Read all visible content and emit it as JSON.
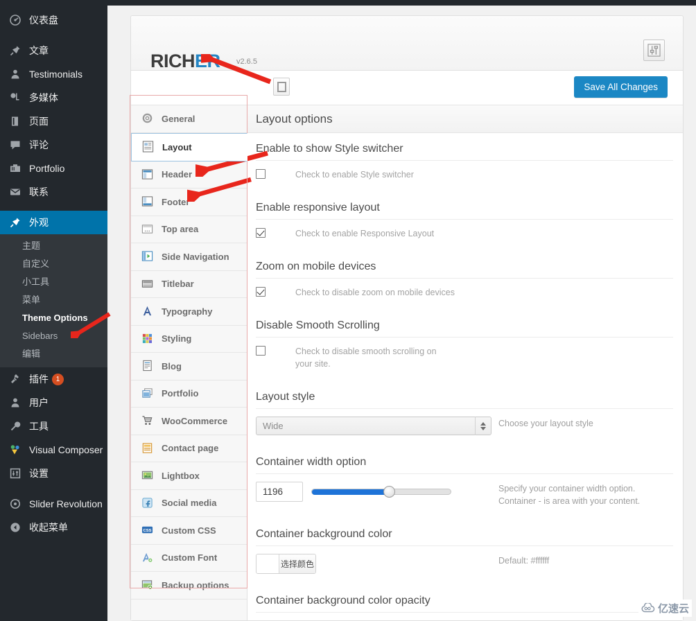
{
  "wp_sidebar": {
    "items": [
      {
        "label": "仪表盘",
        "icon": "dashboard-icon",
        "glyph": "◉"
      },
      {
        "label": "文章",
        "icon": "pin-icon",
        "glyph": "✒"
      },
      {
        "label": "Testimonials",
        "icon": "person-icon",
        "glyph": "👤"
      },
      {
        "label": "多媒体",
        "icon": "media-icon",
        "glyph": "♫"
      },
      {
        "label": "页面",
        "icon": "page-icon",
        "glyph": "▤"
      },
      {
        "label": "评论",
        "icon": "comment-icon",
        "glyph": "💬"
      },
      {
        "label": "Portfolio",
        "icon": "portfolio-icon",
        "glyph": "🗂"
      },
      {
        "label": "联系",
        "icon": "mail-icon",
        "glyph": "✉"
      }
    ],
    "active_item": {
      "label": "外观",
      "icon": "appearance-icon",
      "glyph": "✒"
    },
    "submenu": [
      {
        "label": "主题",
        "current": false
      },
      {
        "label": "自定义",
        "current": false
      },
      {
        "label": "小工具",
        "current": false
      },
      {
        "label": "菜单",
        "current": false
      },
      {
        "label": "Theme Options",
        "current": true
      },
      {
        "label": "Sidebars",
        "current": false
      },
      {
        "label": "编辑",
        "current": false
      }
    ],
    "items_bottom": [
      {
        "label": "插件",
        "icon": "plugin-icon",
        "glyph": "🔌",
        "badge": "1"
      },
      {
        "label": "用户",
        "icon": "users-icon",
        "glyph": "👤",
        "badge": ""
      },
      {
        "label": "工具",
        "icon": "tools-icon",
        "glyph": "🔧",
        "badge": ""
      },
      {
        "label": "Visual Composer",
        "icon": "visual-composer-icon",
        "glyph": "❖",
        "badge": ""
      },
      {
        "label": "设置",
        "icon": "settings-icon",
        "glyph": "⚙",
        "badge": ""
      }
    ],
    "items_footer": [
      {
        "label": "Slider Revolution",
        "icon": "slider-revolution-icon",
        "glyph": "◎"
      },
      {
        "label": "收起菜单",
        "icon": "collapse-icon",
        "glyph": "◀"
      }
    ]
  },
  "theme_panel": {
    "logo_prefix": "RICH",
    "logo_suffix": "ER",
    "version": "v2.6.5",
    "header_icon": "sliders-icon",
    "expand_icon": "expand-options-icon",
    "save_label": "Save All Changes"
  },
  "options_nav": [
    {
      "label": "General",
      "icon": "gear-icon",
      "active": false
    },
    {
      "label": "Layout",
      "icon": "layout-icon",
      "active": true
    },
    {
      "label": "Header",
      "icon": "header-icon",
      "active": false
    },
    {
      "label": "Footer",
      "icon": "footer-icon",
      "active": false
    },
    {
      "label": "Top area",
      "icon": "top-area-icon",
      "active": false
    },
    {
      "label": "Side Navigation",
      "icon": "side-navigation-icon",
      "active": false
    },
    {
      "label": "Titlebar",
      "icon": "titlebar-icon",
      "active": false
    },
    {
      "label": "Typography",
      "icon": "typography-icon",
      "active": false
    },
    {
      "label": "Styling",
      "icon": "styling-icon",
      "active": false
    },
    {
      "label": "Blog",
      "icon": "blog-icon",
      "active": false
    },
    {
      "label": "Portfolio",
      "icon": "portfolio-icon",
      "active": false
    },
    {
      "label": "WooCommerce",
      "icon": "woocommerce-cart-icon",
      "active": false
    },
    {
      "label": "Contact page",
      "icon": "contact-page-icon",
      "active": false
    },
    {
      "label": "Lightbox",
      "icon": "lightbox-icon",
      "active": false
    },
    {
      "label": "Social media",
      "icon": "social-media-icon",
      "active": false
    },
    {
      "label": "Custom CSS",
      "icon": "custom-css-icon",
      "active": false
    },
    {
      "label": "Custom Font",
      "icon": "custom-font-icon",
      "active": false
    },
    {
      "label": "Backup options",
      "icon": "backup-options-icon",
      "active": false
    }
  ],
  "main": {
    "title": "Layout options",
    "fields": [
      {
        "id": "style-switcher",
        "title": "Enable to show Style switcher",
        "type": "checkbox",
        "checked": false,
        "label": "Check to enable Style switcher",
        "desc": ""
      },
      {
        "id": "responsive-layout",
        "title": "Enable responsive layout",
        "type": "checkbox",
        "checked": true,
        "label": "Check to enable Responsive Layout",
        "desc": ""
      },
      {
        "id": "zoom-mobile",
        "title": "Zoom on mobile devices",
        "type": "checkbox",
        "checked": true,
        "label": "Check to disable zoom on mobile devices",
        "desc": ""
      },
      {
        "id": "smooth-scrolling",
        "title": "Disable Smooth Scrolling",
        "type": "checkbox",
        "checked": false,
        "label": "Check to disable smooth scrolling on your site.",
        "desc": ""
      },
      {
        "id": "layout-style",
        "title": "Layout style",
        "type": "select",
        "value": "Wide",
        "desc": "Choose your layout style"
      },
      {
        "id": "container-width",
        "title": "Container width option",
        "type": "slider",
        "value": "1196",
        "desc": "Specify your container width option. Container - is area with your content."
      },
      {
        "id": "container-bg-color",
        "title": "Container background color",
        "type": "color",
        "button_label": "选择颜色",
        "swatch": "#ffffff",
        "desc": "Default: #ffffff"
      },
      {
        "id": "container-bg-opacity",
        "title": "Container background color opacity",
        "type": "partial",
        "desc": ""
      }
    ]
  },
  "watermark": {
    "text": "亿速云",
    "icon": "cloud-icon"
  },
  "colors": {
    "wp_sidebar_bg": "#23282d",
    "wp_submenu_bg": "#32373c",
    "wp_active_blue": "#0073aa",
    "save_button_blue": "#1b87c4",
    "slider_blue": "#1e73d8",
    "logo_blue": "#2485c4",
    "badge_orange": "#d54e21",
    "annotation_red": "#e8261c"
  }
}
